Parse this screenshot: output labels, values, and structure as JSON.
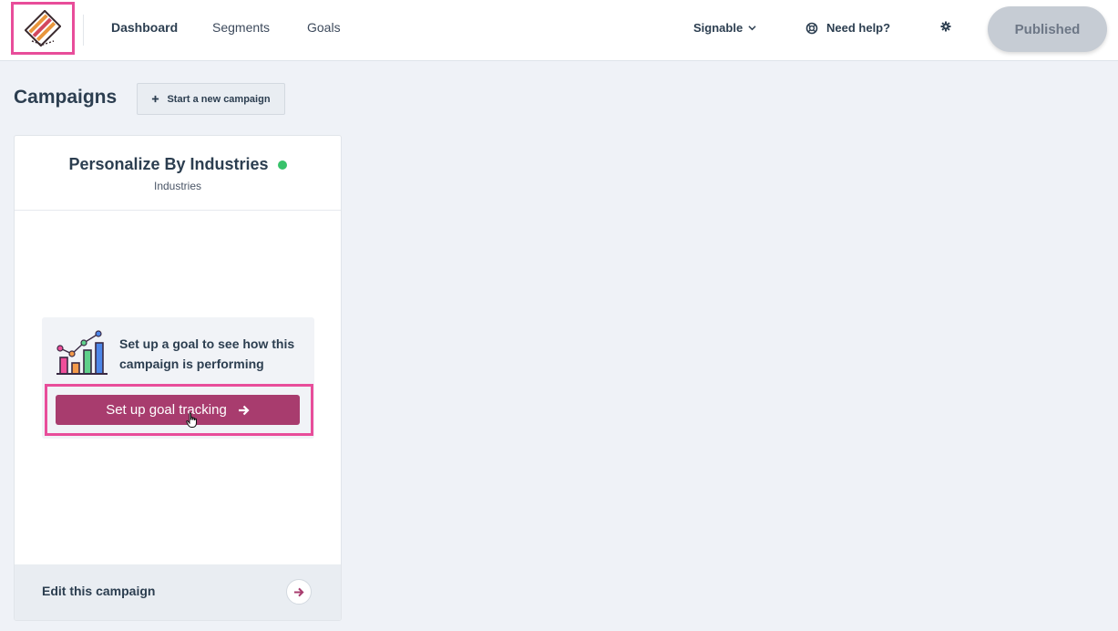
{
  "nav": {
    "links": [
      {
        "label": "Dashboard",
        "active": true
      },
      {
        "label": "Segments",
        "active": false
      },
      {
        "label": "Goals",
        "active": false
      }
    ],
    "account_label": "Signable",
    "help_label": "Need help?",
    "publish_label": "Published"
  },
  "page": {
    "title": "Campaigns",
    "new_campaign_label": "Start a new campaign"
  },
  "campaign": {
    "title": "Personalize By Industries",
    "subtitle": "Industries",
    "status_color": "#37c26a",
    "goal_prompt": "Set up a goal to see how this campaign is performing",
    "goal_button_label": "Set up goal tracking",
    "footer_label": "Edit this campaign"
  },
  "colors": {
    "accent": "#a83c6e",
    "highlight": "#e84d9a",
    "background": "#eff2f7"
  },
  "icons": {
    "logo": "stacked-stripes-logo",
    "account_chevron": "chevron-down-icon",
    "help": "lifebuoy-icon",
    "settings": "gear-icon",
    "plus": "plus-icon",
    "goal_illustration": "bar-chart-icon",
    "arrow": "arrow-right-icon",
    "cursor": "hand-pointer-icon"
  }
}
